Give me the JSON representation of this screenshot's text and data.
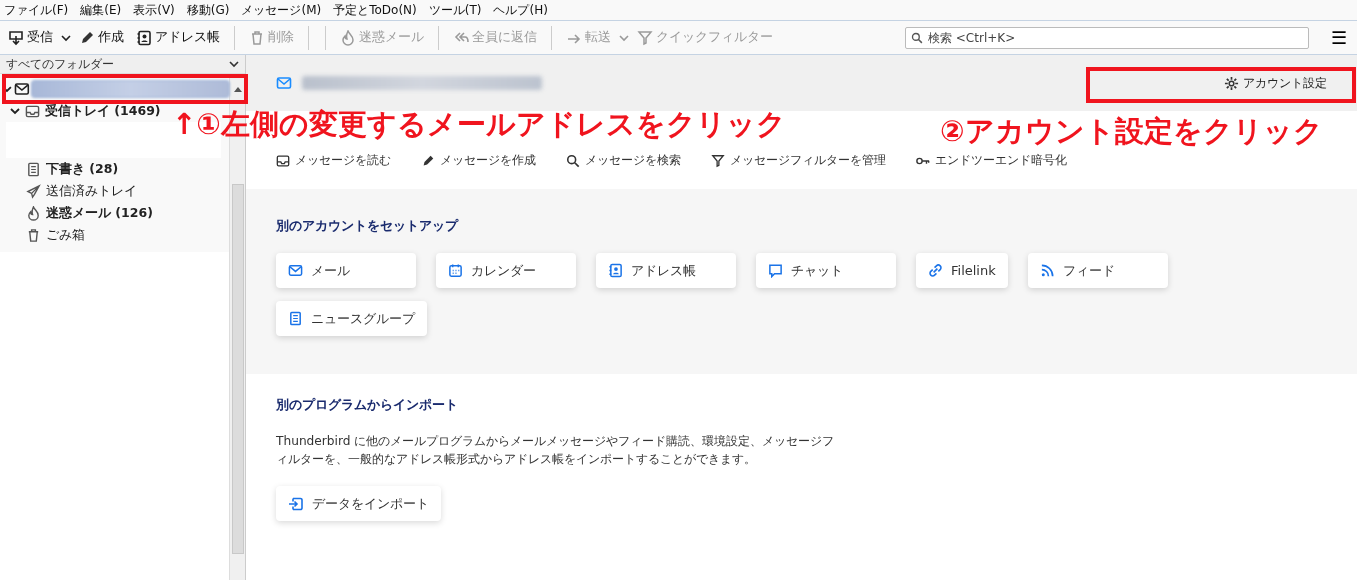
{
  "menu_bar": [
    "ファイル(F)",
    "編集(E)",
    "表示(V)",
    "移動(G)",
    "メッセージ(M)",
    "予定とToDo(N)",
    "ツール(T)",
    "ヘルプ(H)"
  ],
  "toolbar": [
    {
      "kind": "get",
      "label": "受信",
      "disabled": false,
      "dropdown": true
    },
    {
      "kind": "write",
      "label": "作成",
      "disabled": false,
      "dropdown": false
    },
    {
      "kind": "book",
      "label": "アドレス帳",
      "disabled": false,
      "dropdown": false
    },
    {
      "kind": "separator"
    },
    {
      "kind": "trash",
      "label": "削除",
      "disabled": true,
      "dropdown": false
    },
    {
      "kind": "separator"
    },
    {
      "kind": "separator"
    },
    {
      "kind": "flame",
      "label": "迷惑メール",
      "disabled": true,
      "dropdown": false
    },
    {
      "kind": "separator"
    },
    {
      "kind": "replyall",
      "label": "全員に返信",
      "disabled": true,
      "dropdown": false
    },
    {
      "kind": "separator"
    },
    {
      "kind": "forward",
      "label": "転送",
      "disabled": true,
      "dropdown": true
    },
    {
      "kind": "filter",
      "label": "クイックフィルター",
      "disabled": true,
      "dropdown": false
    }
  ],
  "search": {
    "placeholder": "検索 <Ctrl+K>"
  },
  "menu_button": "☰",
  "folder_pane": {
    "header": "すべてのフォルダー",
    "account": {
      "expanded": true,
      "selected": true
    },
    "folders": [
      {
        "kind": "inbox",
        "label": "受信トレイ (1469)",
        "unread": true,
        "expanded": true
      },
      {
        "kind": "draft",
        "label": "下書き (28)",
        "unread": true
      },
      {
        "kind": "sent",
        "label": "送信済みトレイ",
        "unread": false
      },
      {
        "kind": "flame",
        "label": "迷惑メール (126)",
        "unread": true
      },
      {
        "kind": "trash",
        "label": "ごみ箱",
        "unread": false
      }
    ]
  },
  "account_header": {
    "settings_button": "アカウント設定"
  },
  "actions": [
    {
      "kind": "inbox",
      "label": "メッセージを読む"
    },
    {
      "kind": "write",
      "label": "メッセージを作成"
    },
    {
      "kind": "search",
      "label": "メッセージを検索"
    },
    {
      "kind": "filter",
      "label": "メッセージフィルターを管理"
    },
    {
      "kind": "key",
      "label": "エンドツーエンド暗号化"
    }
  ],
  "setup_section": {
    "heading": "別のアカウントをセットアップ",
    "buttons": [
      {
        "kind": "mail",
        "label": "メール"
      },
      {
        "kind": "calendar",
        "label": "カレンダー"
      },
      {
        "kind": "book",
        "label": "アドレス帳"
      },
      {
        "kind": "chat",
        "label": "チャット"
      },
      {
        "kind": "link",
        "label": "Filelink"
      },
      {
        "kind": "rss",
        "label": "フィード"
      },
      {
        "kind": "doc",
        "label": "ニュースグループ"
      }
    ]
  },
  "import_section": {
    "heading": "別のプログラムからインポート",
    "description": "Thunderbird に他のメールプログラムからメールメッセージやフィード購読、環境設定、メッセージフィルターを、一般的なアドレス帳形式からアドレス帳をインポートすることができます。",
    "button": "データをインポート"
  },
  "annotations": [
    "↑①左側の変更するメールアドレスをクリック",
    "②アカウント設定をクリック"
  ]
}
